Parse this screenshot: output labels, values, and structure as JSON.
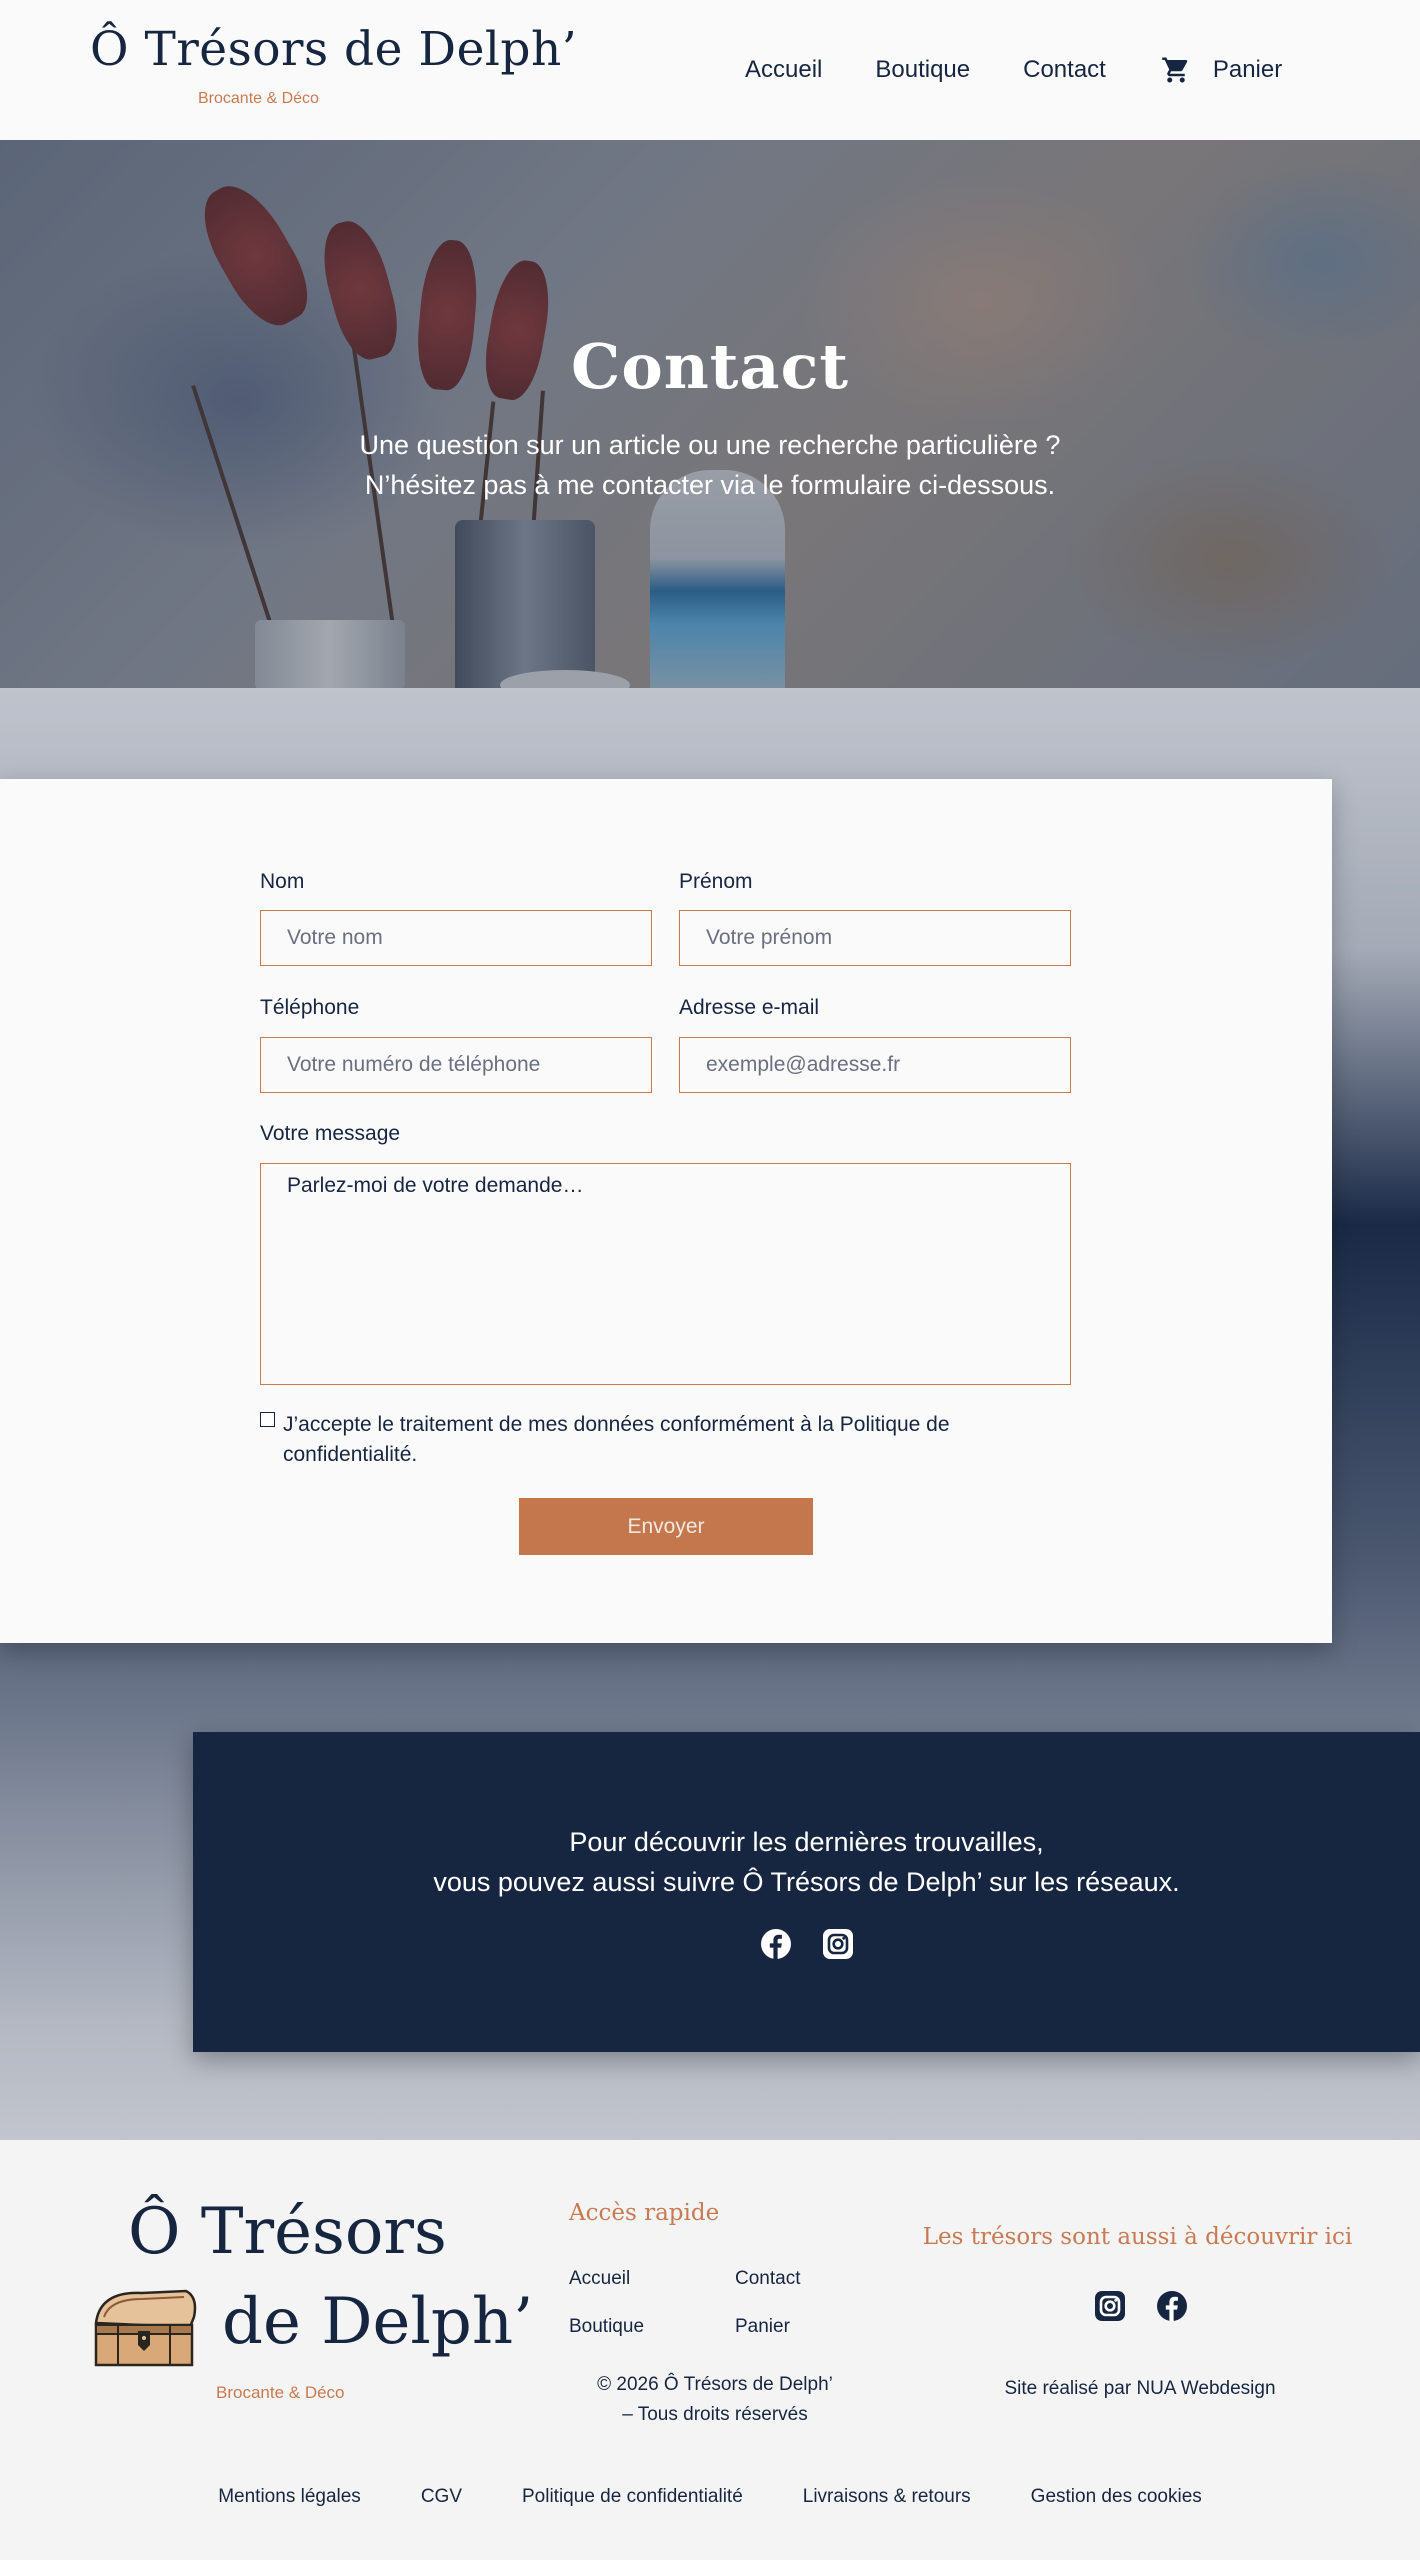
{
  "brand": {
    "name": "Ô Trésors de Delph’",
    "tagline": "Brocante & Déco",
    "footer_line1": "Ô Trésors",
    "footer_line2": "de Delph’"
  },
  "nav": {
    "items": [
      {
        "label": "Accueil"
      },
      {
        "label": "Boutique"
      },
      {
        "label": "Contact"
      },
      {
        "label": "Panier",
        "icon": "cart-icon"
      }
    ]
  },
  "hero": {
    "title": "Contact",
    "line1": "Une question sur un article ou une recherche particulière ?",
    "line2": "N’hésitez pas à me contacter via le formulaire ci-dessous."
  },
  "form": {
    "nom": {
      "label": "Nom",
      "placeholder": "Votre nom"
    },
    "prenom": {
      "label": "Prénom",
      "placeholder": "Votre prénom"
    },
    "telephone": {
      "label": "Téléphone",
      "placeholder": "Votre numéro de téléphone"
    },
    "email": {
      "label": "Adresse e-mail",
      "placeholder": "exemple@adresse.fr"
    },
    "message": {
      "label": "Votre message",
      "placeholder": "Parlez-moi de votre demande…"
    },
    "consent": "J’accepte le traitement de mes données conformément à la Politique de confidentialité.",
    "consent_checked": false,
    "submit": "Envoyer"
  },
  "banner": {
    "line1": "Pour découvrir les dernières trouvailles,",
    "line2": "vous pouvez aussi suivre Ô Trésors de Delph’ sur les réseaux.",
    "icons": [
      "facebook-icon",
      "instagram-icon"
    ]
  },
  "footer": {
    "quick_title": "Accès rapide",
    "quick_links": [
      "Accueil",
      "Contact",
      "Boutique",
      "Panier"
    ],
    "copyright_line1": "© 2026 Ô Trésors de Delph’",
    "copyright_line2": "– Tous droits réservés",
    "social_title": "Les trésors sont aussi à découvrir ici",
    "social_icons": [
      "instagram-icon",
      "facebook-icon"
    ],
    "credit": "Site réalisé par NUA Webdesign",
    "legal_links": [
      "Mentions légales",
      "CGV",
      "Politique de confidentialité",
      "Livraisons & retours",
      "Gestion des cookies"
    ]
  },
  "colors": {
    "navy": "#172640",
    "accent": "#c4764c",
    "background": "#f4f4f4"
  }
}
